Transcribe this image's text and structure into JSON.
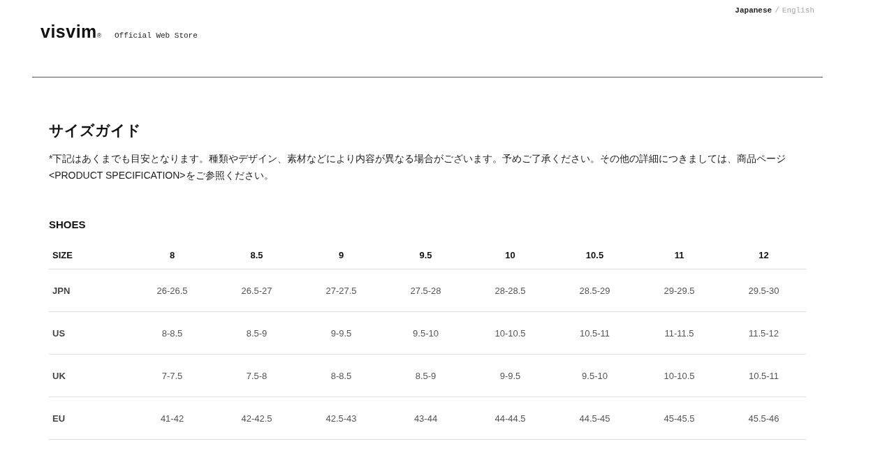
{
  "language_switch": {
    "items": [
      {
        "label": "Japanese",
        "selected": true
      },
      {
        "label": "English",
        "selected": false
      }
    ],
    "separator": "/"
  },
  "header": {
    "logo": "visvim",
    "logo_mark": "®",
    "tagline": "Official Web Store"
  },
  "page_title": "サイズガイド",
  "note": "*下記はあくまでも目安となります。種類やデザイン、素材などにより内容が異なる場合がございます。予めご了承ください。その他の詳細につきましては、商品ページ<PRODUCT SPECIFICATION>をご参照ください。",
  "section_title": "SHOES",
  "table": {
    "columns": [
      "SIZE",
      "8",
      "8.5",
      "9",
      "9.5",
      "10",
      "10.5",
      "11",
      "12"
    ],
    "rows": [
      [
        "JPN",
        "26-26.5",
        "26.5-27",
        "27-27.5",
        "27.5-28",
        "28-28.5",
        "28.5-29",
        "29-29.5",
        "29.5-30"
      ],
      [
        "US",
        "8-8.5",
        "8.5-9",
        "9-9.5",
        "9.5-10",
        "10-10.5",
        "10.5-11",
        "11-11.5",
        "11.5-12"
      ],
      [
        "UK",
        "7-7.5",
        "7.5-8",
        "8-8.5",
        "8.5-9",
        "9-9.5",
        "9.5-10",
        "10-10.5",
        "10.5-11"
      ],
      [
        "EU",
        "41-42",
        "42-42.5",
        "42.5-43",
        "43-44",
        "44-44.5",
        "44.5-45",
        "45-45.5",
        "45.5-46"
      ]
    ]
  }
}
